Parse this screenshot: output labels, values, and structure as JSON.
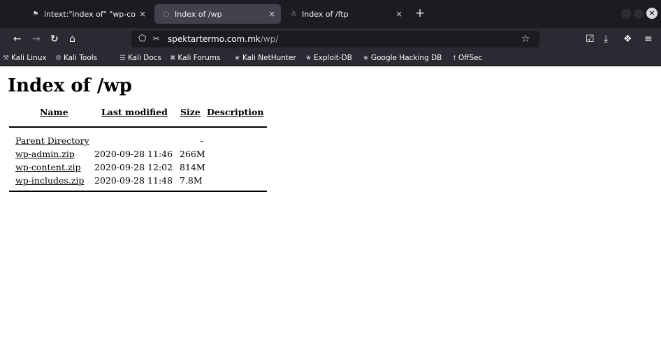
{
  "tabs": [
    {
      "icon": "⚑",
      "title": "intext:\"index of\" \"wp-con",
      "close": "×",
      "active": false
    },
    {
      "icon": "◌",
      "title": "Index of /wp",
      "close": "×",
      "active": true
    },
    {
      "icon": "☃",
      "title": "Index of /ftp",
      "close": "×",
      "active": false
    }
  ],
  "new_tab_label": "+",
  "window_close_label": "×",
  "nav": {
    "back": "←",
    "forward": "→",
    "reload": "↻",
    "home": "⌂",
    "shield": "⬠",
    "lock": "✂",
    "url_host": "spektartermo.com.mk",
    "url_path": "/wp/",
    "bookmark_star": "☆",
    "pocket": "☑",
    "download": "⤓",
    "extensions": "❖",
    "menu": "≡"
  },
  "bookmarks": [
    {
      "icon": "⚒",
      "label": "Kali Linux"
    },
    {
      "icon": "⚙",
      "label": "Kali Tools"
    },
    {
      "icon": "☰",
      "label": "Kali Docs"
    },
    {
      "icon": "✖",
      "label": "Kali Forums"
    },
    {
      "icon": "★",
      "label": "Kali NetHunter"
    },
    {
      "icon": "★",
      "label": "Exploit-DB"
    },
    {
      "icon": "★",
      "label": "Google Hacking DB"
    },
    {
      "icon": "†",
      "label": "OffSec"
    }
  ],
  "page": {
    "heading": "Index of /wp",
    "columns": {
      "name": "Name",
      "modified": "Last modified",
      "size": "Size",
      "description": "Description"
    },
    "rows": [
      {
        "name": "Parent Directory",
        "modified": "",
        "size": "-",
        "description": ""
      },
      {
        "name": "wp-admin.zip",
        "modified": "2020-09-28 11:46",
        "size": "266M",
        "description": ""
      },
      {
        "name": "wp-content.zip",
        "modified": "2020-09-28 12:02",
        "size": "814M",
        "description": ""
      },
      {
        "name": "wp-includes.zip",
        "modified": "2020-09-28 11:48",
        "size": "7.8M",
        "description": ""
      }
    ]
  },
  "colors": {
    "chrome_bg": "#1c1b22",
    "toolbar_bg": "#2b2a33",
    "active_tab_bg": "#42414d",
    "link": "#000000"
  }
}
